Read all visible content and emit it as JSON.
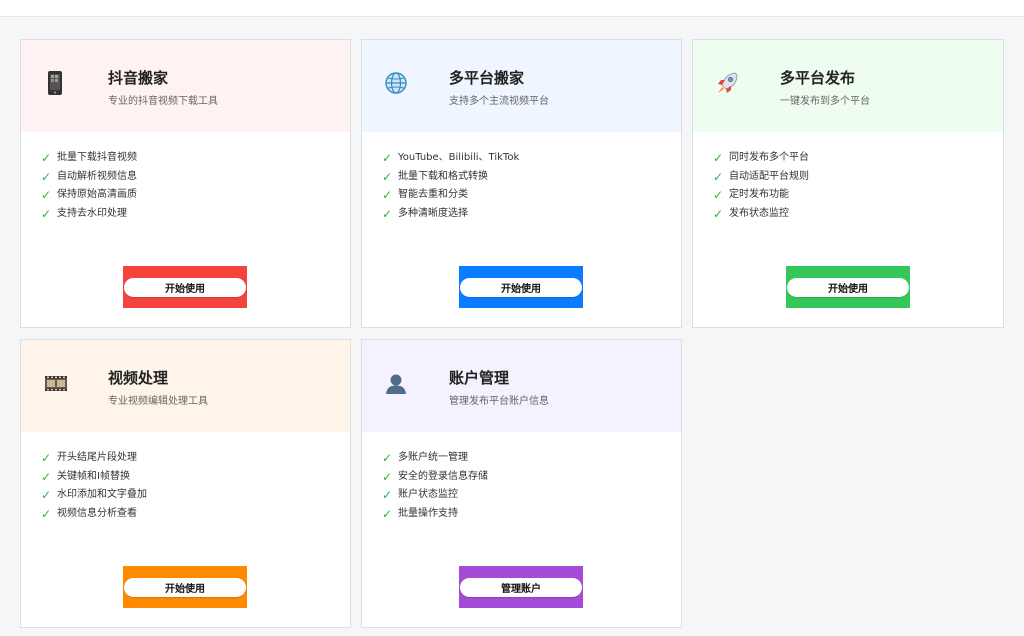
{
  "cards": [
    {
      "title": "抖音搬家",
      "subtitle": "专业的抖音视频下载工具",
      "head_bg": "#fff2f2",
      "accent": "#f2443d",
      "icon": "phone-icon",
      "features": [
        "批量下载抖音视频",
        "自动解析视频信息",
        "保持原始高清画质",
        "支持去水印处理"
      ],
      "button_label": "开始使用"
    },
    {
      "title": "多平台搬家",
      "subtitle": "支持多个主流视频平台",
      "head_bg": "#eff6ff",
      "accent": "#0a7cff",
      "icon": "globe-icon",
      "features": [
        "YouTube、Bilibili、TikTok",
        "批量下载和格式转换",
        "智能去重和分类",
        "多种清晰度选择"
      ],
      "button_label": "开始使用"
    },
    {
      "title": "多平台发布",
      "subtitle": "一键发布到多个平台",
      "head_bg": "#effdf0",
      "accent": "#34c759",
      "icon": "rocket-icon",
      "features": [
        "同时发布多个平台",
        "自动适配平台规则",
        "定时发布功能",
        "发布状态监控"
      ],
      "button_label": "开始使用"
    },
    {
      "title": "视频处理",
      "subtitle": "专业视频编辑处理工具",
      "head_bg": "#fff4ea",
      "accent": "#ff8a00",
      "icon": "film-icon",
      "features": [
        "开头结尾片段处理",
        "关键帧和I帧替换",
        "水印添加和文字叠加",
        "视频信息分析查看"
      ],
      "button_label": "开始使用"
    },
    {
      "title": "账户管理",
      "subtitle": "管理发布平台账户信息",
      "head_bg": "#f6f1fe",
      "accent": "#a64ad8",
      "icon": "user-icon",
      "features": [
        "多账户统一管理",
        "安全的登录信息存储",
        "账户状态监控",
        "批量操作支持"
      ],
      "button_label": "管理账户"
    }
  ]
}
